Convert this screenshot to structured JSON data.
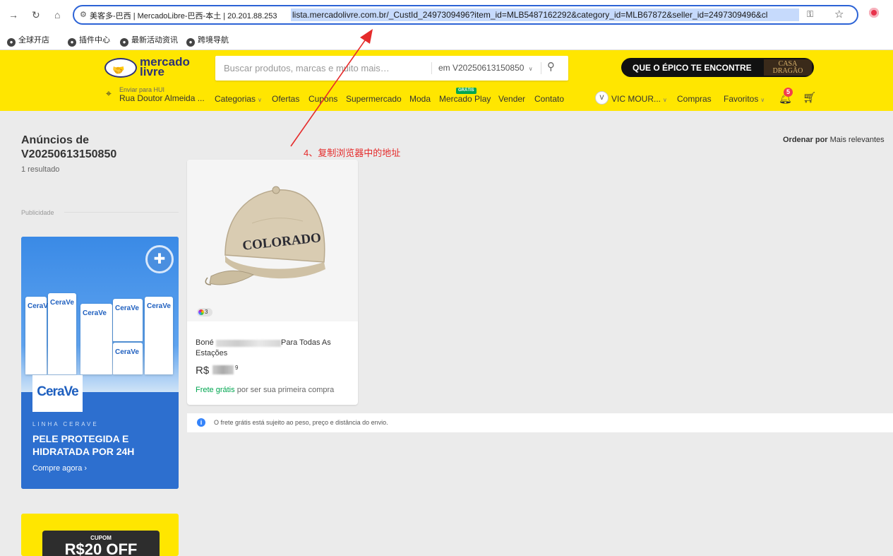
{
  "browser": {
    "tab_title": "美客多-巴西 | MercadoLibre-巴西-本土 | 20.201.88.253",
    "url": "lista.mercadolivre.com.br/_CustId_2497309496?item_id=MLB5487162292&category_id=MLB67872&seller_id=2497309496&cl",
    "bookmarks": [
      "全球开店",
      "插件中心",
      "最新活动资讯",
      "跨境导航"
    ]
  },
  "header": {
    "logo_line1": "mercado",
    "logo_line2": "livre",
    "search_placeholder": "Buscar produtos, marcas e muito mais…",
    "search_scope": "em V20250613150850",
    "promo": "QUE O ÉPICO TE ENCONTRE",
    "promo_badge_1": "CASA",
    "promo_badge_2": "DRAGÃO",
    "location_l1": "Enviar para HUI",
    "location_l2": "Rua Doutor Almeida ...",
    "nav": [
      "Categorias",
      "Ofertas",
      "Cupons",
      "Supermercado",
      "Moda",
      "Mercado Play",
      "Vender",
      "Contato"
    ],
    "gratis_badge": "GRÁTIS",
    "avatar_initial": "V",
    "user": "VIC MOUR...",
    "compras": "Compras",
    "favoritos": "Favoritos",
    "notifications": "5"
  },
  "sidebar": {
    "title": "Anúncios de V20250613150850",
    "results": "1 resultado",
    "ad_label": "Publicidade",
    "ad1_logo": "CeraVe",
    "ad1_brand": "LINHA CERAVE",
    "ad1_headline": "PELE PROTEGIDA E HIDRATADA POR 24H",
    "ad1_cta": "Compre agora",
    "ad2_label": "CUPOM",
    "ad2_value": "R$20 OFF"
  },
  "sort": {
    "label": "Ordenar por",
    "value": "Mais relevantes"
  },
  "product": {
    "title_start": "Boné",
    "title_end": "Para Todas As",
    "title_line2": "Estações",
    "price_prefix": "R$",
    "price_cents": "9",
    "colors_count": "3",
    "cap_text": "COLORADO",
    "frete_green": "Frete grátis",
    "frete_rest": "por ser sua primeira compra"
  },
  "note": "O frete grátis está sujeito ao peso, preço e distância do envio.",
  "annotation": "4、复制浏览器中的地址",
  "colors": {
    "brand_yellow": "#ffe600",
    "brand_navy": "#2d3277",
    "green": "#00a650",
    "blue": "#3483fa",
    "annotation_red": "#e52b2b"
  }
}
